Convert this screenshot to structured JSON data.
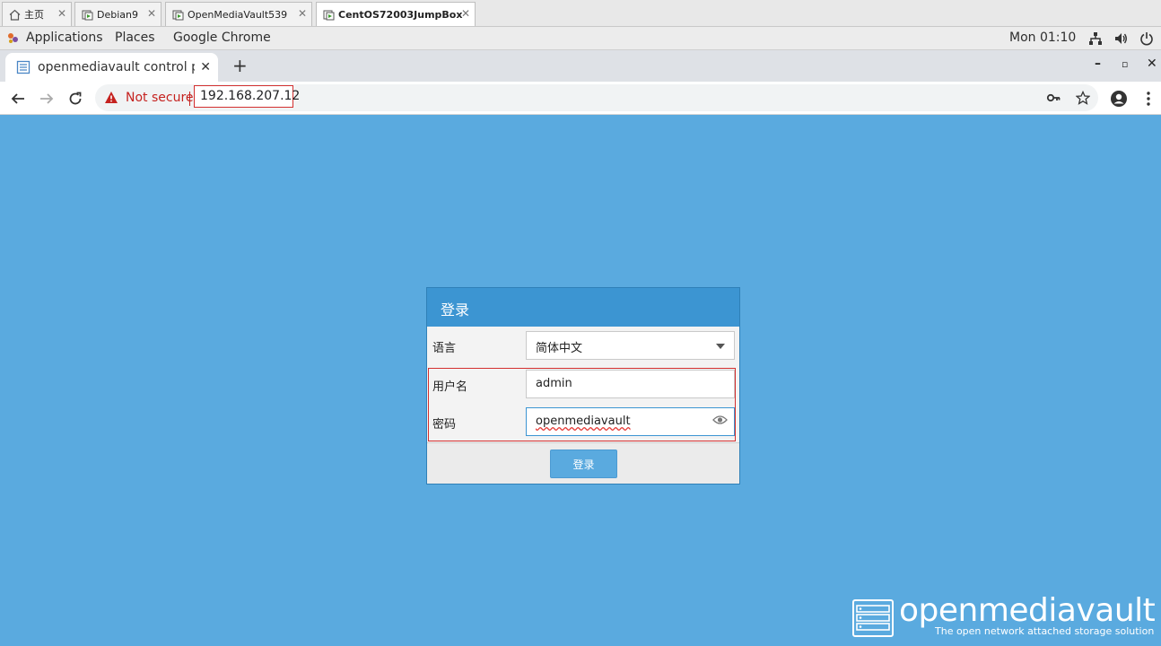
{
  "vm_tabs": [
    {
      "label": "主页",
      "icon": "home-icon"
    },
    {
      "label": "Debian9",
      "icon": "vm-icon"
    },
    {
      "label": "OpenMediaVault539",
      "icon": "vm-icon"
    },
    {
      "label": "CentOS72003JumpBox",
      "icon": "vm-running-icon",
      "active": true
    }
  ],
  "gnome": {
    "applications": "Applications",
    "places": "Places",
    "app_name": "Google Chrome",
    "clock": "Mon 01:10"
  },
  "chrome": {
    "tab_title": "openmediavault control panel",
    "not_secure": "Not secure",
    "url": "192.168.207.12"
  },
  "login": {
    "title": "登录",
    "language_label": "语言",
    "language_value": "简体中文",
    "username_label": "用户名",
    "username_value": "admin",
    "password_label": "密码",
    "password_value": "openmediavault",
    "submit_label": "登录"
  },
  "brand": {
    "name": "openmediavault",
    "tagline": "The open network attached storage solution"
  },
  "colors": {
    "background": "#5aaadf",
    "dialog_header": "#3c95d2",
    "highlight": "#d32f2f"
  }
}
